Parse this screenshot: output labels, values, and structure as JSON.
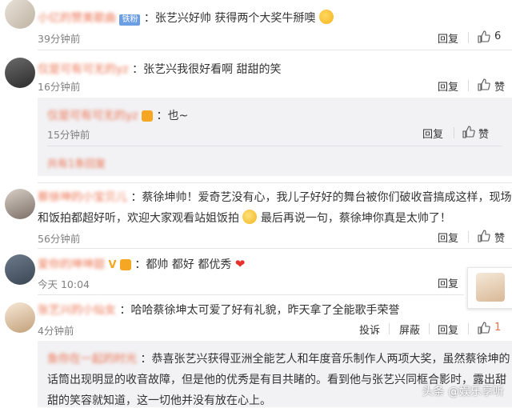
{
  "comments": [
    {
      "user": "小亿的赞美歌曲",
      "badge": "铁粉",
      "text": "：张艺兴好帅 获得两个大奖牛掰噢",
      "time": "39分钟前",
      "reply": "回复",
      "likes": "6"
    },
    {
      "user": "仅是可有可无的yz",
      "text": "：张艺兴我很好看啊  甜甜的笑",
      "time": "16分钟前",
      "reply": "回复",
      "likes": "赞"
    },
    {
      "user": "蔡徐坤的小宝贝儿",
      "text1": "：蔡徐坤帅！爱奇艺没有心，我儿子好好的舞台被你们破收音搞成这样，现场",
      "text2": "和饭拍都超好听，欢迎大家观看站姐饭拍",
      "text3": "最后再说一句，蔡徐坤你真是太帅了！",
      "time": "56分钟前",
      "reply": "回复",
      "likes": "赞"
    },
    {
      "user": "爱你的坤坤甜",
      "text": "：都帅 都好 都优秀",
      "time": "今天 10:04",
      "reply": "回复"
    },
    {
      "user": "张艺兴的小仙女",
      "text": "：哈哈蔡徐坤太可爱了好有礼貌，昨天拿了全能歌手荣誉",
      "time": "4分钟前",
      "report": "投诉",
      "block": "屏蔽",
      "reply": "回复",
      "likes": "1"
    }
  ],
  "nested_reply": {
    "user": "仅是可有可无的yz",
    "text": "：也~",
    "time": "15分钟前",
    "reply": "回复",
    "likes": "赞"
  },
  "more_replies": "共有1条回复",
  "long_reply": {
    "user": "鱼你在一起的时光",
    "line1": "：恭喜张艺兴获得亚洲全能艺人和年度音乐制作人两项大奖，虽然蔡徐坤的",
    "line2": "话筒出现明显的收音故障，但是他的优秀是有目共睹的。看到他与张艺兴同框合影时，露出甜",
    "line3": "甜的笑容就知道，这一切他并没有放在心上。"
  },
  "watermark": "头条 @娱乐享听",
  "colors": {
    "username": "#eb7350",
    "accent": "#fa7d3c",
    "reply_bg": "#f2f2f5"
  },
  "icons": {
    "like": "thumb-up-icon",
    "badge": "fan-badge-icon",
    "vip": "vip-crown-icon"
  }
}
